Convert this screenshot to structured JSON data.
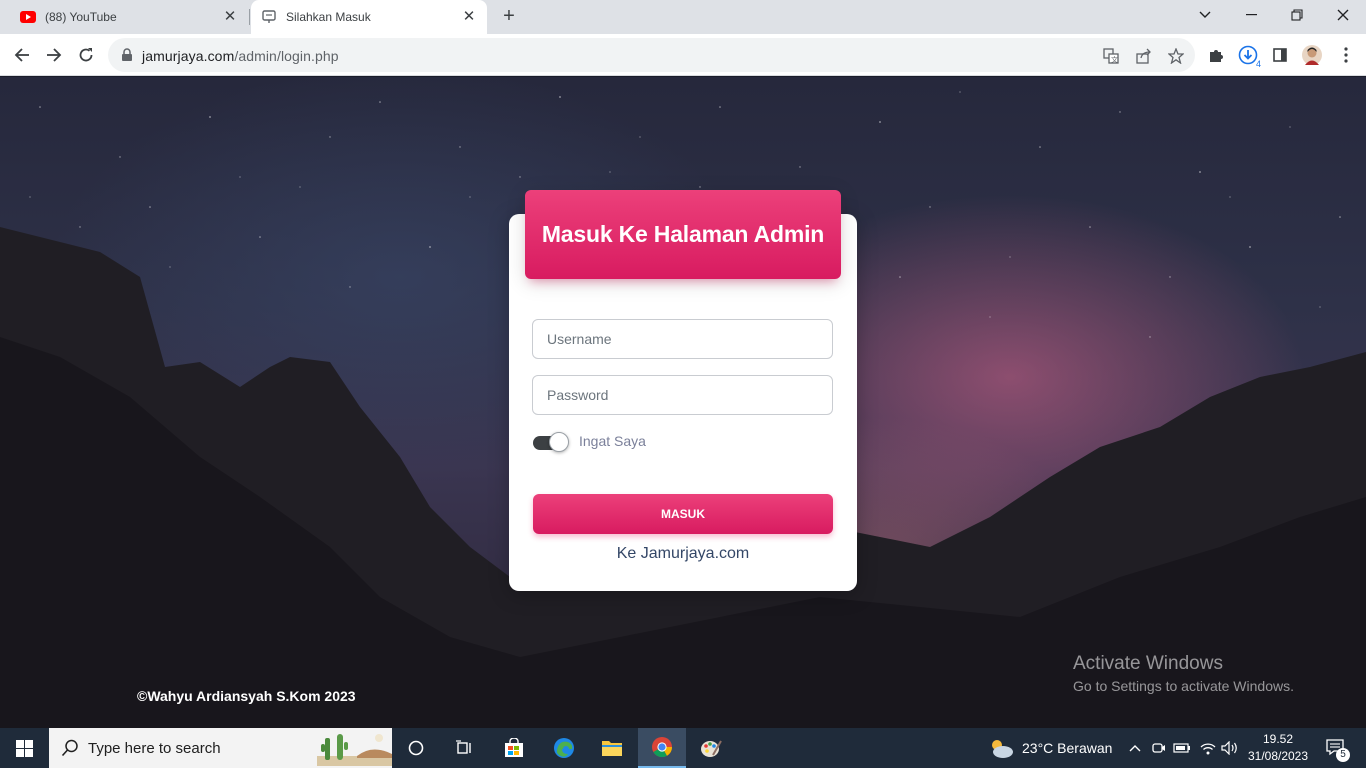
{
  "browser": {
    "tabs": [
      {
        "title": "(88) YouTube",
        "icon": "youtube-icon"
      },
      {
        "title": "Silahkan Masuk",
        "icon": "page-icon"
      }
    ],
    "url_host": "jamurjaya.com",
    "url_path": "/admin/login.php",
    "download_count": "4"
  },
  "login": {
    "header_title": "Masuk Ke Halaman Admin",
    "username_placeholder": "Username",
    "password_placeholder": "Password",
    "remember_label": "Ingat Saya",
    "remember_checked": true,
    "submit_label": "MASUK",
    "home_link": "Ke Jamurjaya.com"
  },
  "footer": {
    "credit": "©Wahyu Ardiansyah S.Kom 2023"
  },
  "watermark": {
    "line1": "Activate Windows",
    "line2": "Go to Settings to activate Windows."
  },
  "taskbar": {
    "search_placeholder": "Type here to search",
    "weather": "23°C  Berawan",
    "time": "19.52",
    "date": "31/08/2023",
    "notification_count": "5"
  },
  "colors": {
    "accent": "#e91e63",
    "taskbar": "#1f2b3a"
  }
}
